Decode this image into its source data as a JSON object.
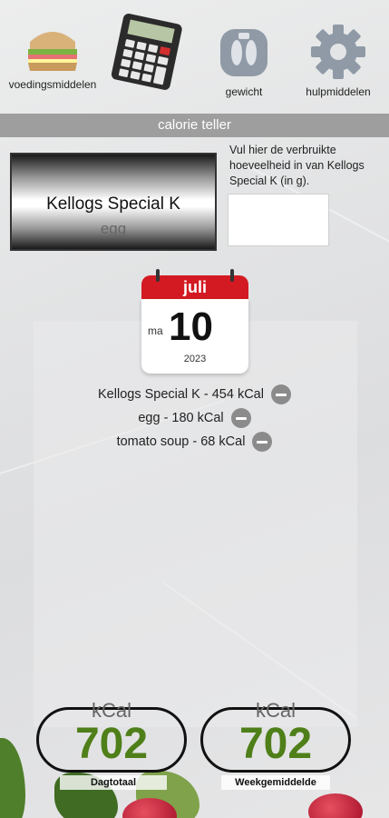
{
  "nav": {
    "items": [
      {
        "label": "voedingsmiddelen",
        "icon": "sandwich-icon"
      },
      {
        "label": "",
        "icon": "calculator-icon"
      },
      {
        "label": "gewicht",
        "icon": "scale-icon"
      },
      {
        "label": "hulpmiddelen",
        "icon": "gear-icon"
      }
    ]
  },
  "title_bar": {
    "label": "calorie teller"
  },
  "picker": {
    "selected": "Kellogs Special K",
    "next": "egg"
  },
  "hint": {
    "text": "Vul hier de verbruikte hoeveelheid in van Kellogs Special K (in g)."
  },
  "amount_input": {
    "value": ""
  },
  "calendar": {
    "month": "juli",
    "weekday": "ma",
    "day": "10",
    "year": "2023"
  },
  "entries": [
    {
      "text": "Kellogs Special K - 454 kCal"
    },
    {
      "text": "egg - 180 kCal"
    },
    {
      "text": "tomato soup - 68 kCal"
    }
  ],
  "totals": {
    "daily": {
      "unit": "kCal",
      "value": "702",
      "label": "Dagtotaal"
    },
    "weekly": {
      "unit": "kCal",
      "value": "702",
      "label": "Weekgemiddelde"
    }
  },
  "colors": {
    "accent_green": "#4f7f19",
    "calendar_red": "#d31a22",
    "title_bar": "#9e9e9e"
  }
}
